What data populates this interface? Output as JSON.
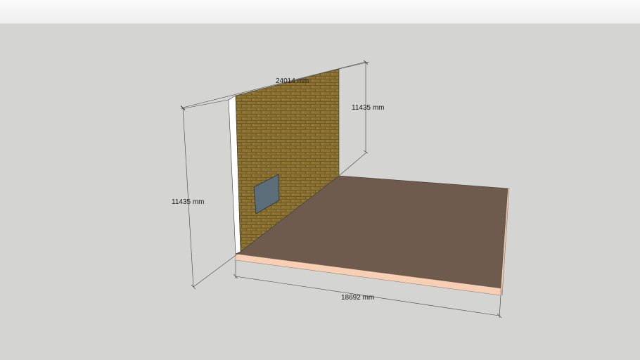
{
  "toolbar": {},
  "scene": {
    "background_color": "#d4d4d2",
    "floor_color": "#6f5b4d",
    "floor_edge_color": "#f7cfb4",
    "wall_texture_color": "#8a7030",
    "wall_side_color": "#ffffff",
    "window_color": "#5c6d76"
  },
  "dimensions": {
    "wall_length": "24014 mm",
    "wall_height_back": "11435 mm",
    "wall_height_front": "11435 mm",
    "floor_length": "18692 mm"
  }
}
